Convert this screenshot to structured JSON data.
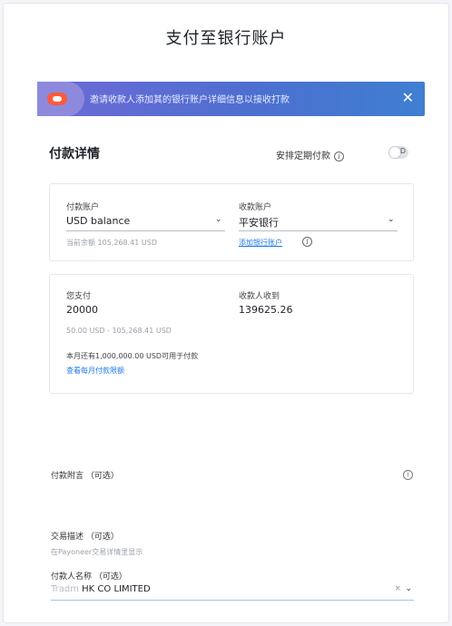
{
  "page": {
    "title": "支付至银行账户"
  },
  "banner": {
    "text": "邀请收款人添加其的银行账户详细信息以接收打款",
    "close_glyph": "✕",
    "colors": {
      "start": "#6d6ad6",
      "end": "#3f7fd1",
      "badge": "#ff5a3c"
    }
  },
  "details": {
    "title": "付款详情",
    "recurring_label": "安排定期付款",
    "info_glyph": "i",
    "toggle_letter": "D",
    "toggle_on": false
  },
  "accounts": {
    "payer_label": "付款账户",
    "payer_value": "USD balance",
    "payer_balance": "当前余额 105,268.41 USD",
    "receiver_label": "收款账户",
    "receiver_value": "平安银行",
    "add_bank_link": "添加银行账户",
    "chevron": "⌄"
  },
  "amount": {
    "pay_label": "您支付",
    "pay_value": "20000",
    "pay_hint": "50.00 USD - 105,268.41 USD",
    "receive_label": "收款人收到",
    "receive_value": "139625.26",
    "limit_text": "本月还有1,000,000.00 USD可用于付款",
    "monthly_link": "查看每月付款限额"
  },
  "memo": {
    "label": "付款附言 （可选）",
    "info_glyph": "i"
  },
  "description": {
    "label": "交易描述 （可选）",
    "hint": "在Payoneer交易详情里显示"
  },
  "payer_name": {
    "label": "付款人名称 （可选）",
    "prefix": "Tradm",
    "value": "HK CO LIMITED",
    "clear_glyph": "×",
    "chevron": "⌄"
  }
}
